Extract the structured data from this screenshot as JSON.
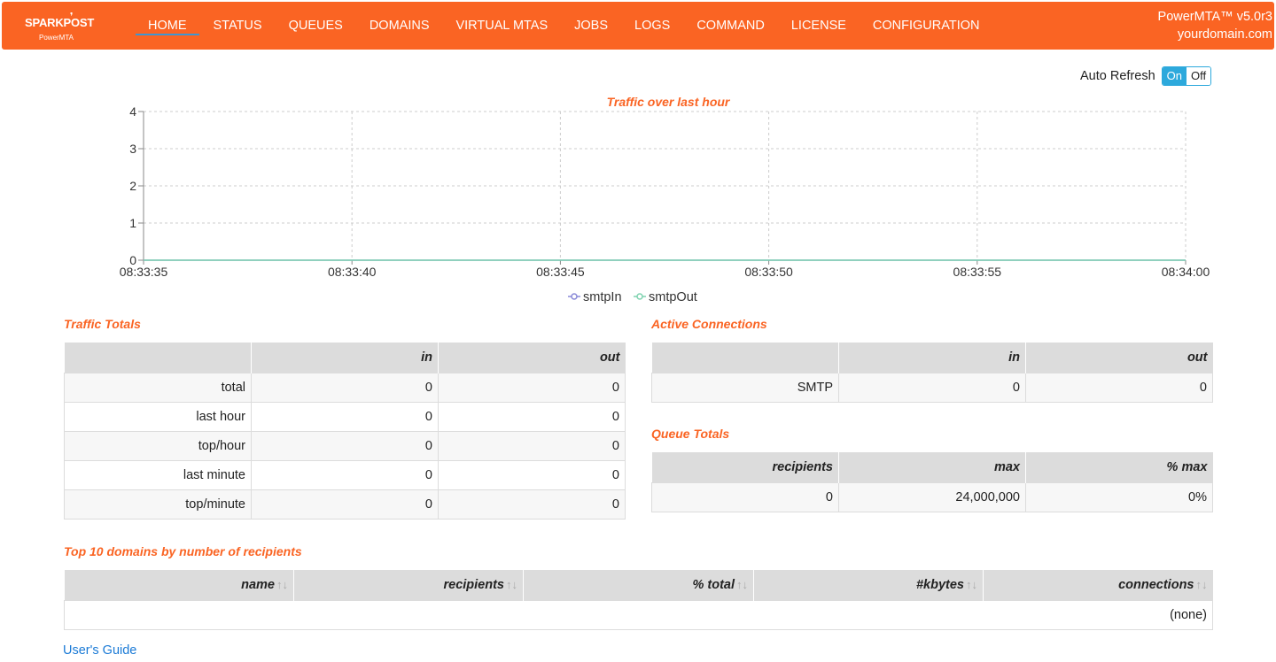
{
  "brand": {
    "name": "SPARKPOST",
    "sub": "PowerMTA"
  },
  "nav": {
    "items": [
      {
        "label": "HOME"
      },
      {
        "label": "STATUS"
      },
      {
        "label": "QUEUES"
      },
      {
        "label": "DOMAINS"
      },
      {
        "label": "VIRTUAL MTAS"
      },
      {
        "label": "JOBS"
      },
      {
        "label": "LOGS"
      },
      {
        "label": "COMMAND"
      },
      {
        "label": "LICENSE"
      },
      {
        "label": "CONFIGURATION"
      }
    ],
    "active": "HOME"
  },
  "version": {
    "product": "PowerMTA™ v5.0r3",
    "host": "yourdomain.com"
  },
  "autorefresh": {
    "label": "Auto Refresh",
    "on": "On",
    "off": "Off",
    "state": "On"
  },
  "chart_data": {
    "type": "line",
    "title": "Traffic over last hour",
    "x": [
      "08:33:35",
      "08:33:40",
      "08:33:45",
      "08:33:50",
      "08:33:55",
      "08:34:00"
    ],
    "series": [
      {
        "name": "smtpIn",
        "values": [
          0,
          0,
          0,
          0,
          0,
          0
        ],
        "color": "#8a8ad8"
      },
      {
        "name": "smtpOut",
        "values": [
          0,
          0,
          0,
          0,
          0,
          0
        ],
        "color": "#7fd3b0"
      }
    ],
    "yticks": [
      0,
      1,
      2,
      3,
      4
    ],
    "ylim": [
      0,
      4
    ],
    "grid": true,
    "legend": "bottom-center"
  },
  "traffic_totals": {
    "title": "Traffic Totals",
    "headers": [
      "",
      "in",
      "out"
    ],
    "rows": [
      [
        "total",
        "0",
        "0"
      ],
      [
        "last hour",
        "0",
        "0"
      ],
      [
        "top/hour",
        "0",
        "0"
      ],
      [
        "last minute",
        "0",
        "0"
      ],
      [
        "top/minute",
        "0",
        "0"
      ]
    ]
  },
  "active_connections": {
    "title": "Active Connections",
    "headers": [
      "",
      "in",
      "out"
    ],
    "rows": [
      [
        "SMTP",
        "0",
        "0"
      ]
    ]
  },
  "queue_totals": {
    "title": "Queue Totals",
    "headers": [
      "recipients",
      "max",
      "% max"
    ],
    "rows": [
      [
        "0",
        "24,000,000",
        "0%"
      ]
    ]
  },
  "top_domains": {
    "title": "Top 10 domains by number of recipients",
    "headers": [
      "name",
      "recipients",
      "% total",
      "#kbytes",
      "connections"
    ],
    "sort_icon": "↑↓",
    "empty": "(none)"
  },
  "footer": {
    "guide": "User's Guide"
  }
}
